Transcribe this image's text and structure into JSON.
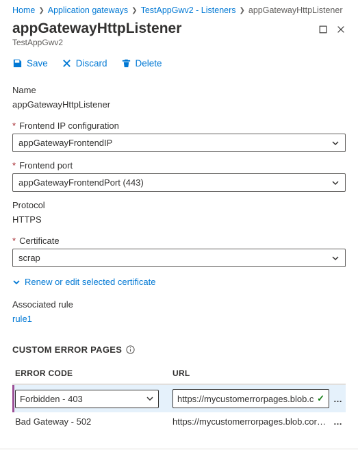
{
  "breadcrumb": {
    "home": "Home",
    "gateways": "Application gateways",
    "instance": "TestAppGwv2 - Listeners",
    "current": "appGatewayHttpListener"
  },
  "header": {
    "title": "appGatewayHttpListener",
    "subtitle": "TestAppGwv2"
  },
  "toolbar": {
    "save": "Save",
    "discard": "Discard",
    "delete": "Delete"
  },
  "fields": {
    "name_label": "Name",
    "name_value": "appGatewayHttpListener",
    "feip_label": "Frontend IP configuration",
    "feip_value": "appGatewayFrontendIP",
    "feport_label": "Frontend port",
    "feport_value": "appGatewayFrontendPort (443)",
    "protocol_label": "Protocol",
    "protocol_value": "HTTPS",
    "cert_label": "Certificate",
    "cert_value": "scrap"
  },
  "renew_link": "Renew or edit selected certificate",
  "assoc": {
    "label": "Associated rule",
    "value": "rule1"
  },
  "custom_err": {
    "heading": "CUSTOM ERROR PAGES",
    "col_error": "ERROR CODE",
    "col_url": "URL",
    "rows": {
      "r0": {
        "code": "Forbidden - 403",
        "url": "https://mycustomerrorpages.blob.core.w"
      },
      "r1": {
        "code": "Bad Gateway - 502",
        "url": "https://mycustomerrorpages.blob.core.wind…"
      }
    }
  }
}
